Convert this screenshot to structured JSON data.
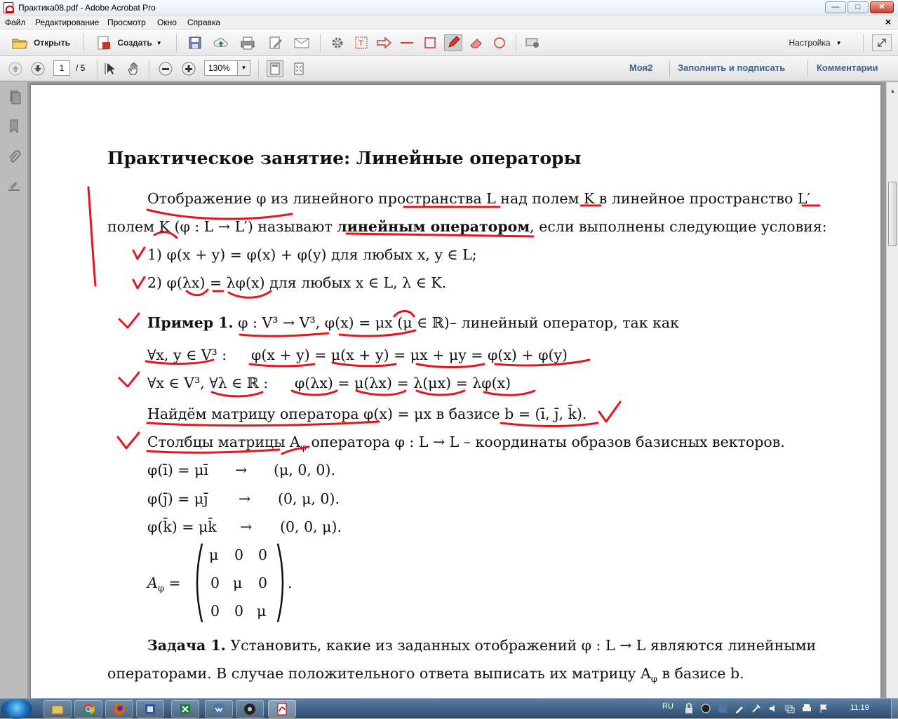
{
  "window": {
    "title": "Практика08.pdf - Adobe Acrobat Pro",
    "minimize": "—",
    "maximize": "□",
    "close": "✕"
  },
  "menu": {
    "items": [
      "Файл",
      "Редактирование",
      "Просмотр",
      "Окно",
      "Справка"
    ],
    "close_doc": "×"
  },
  "toolbar": {
    "open": "Открыть",
    "create": "Создать",
    "settings": "Настройка"
  },
  "nav": {
    "current_page": "1",
    "page_total": "/ 5",
    "zoom": "130%"
  },
  "right_links": [
    "Моя2",
    "Заполнить и подписать",
    "Комментарии"
  ],
  "document": {
    "heading": "Практическое занятие: Линейные операторы",
    "p1_line1": "Отображение φ из линейного пространства L над полем K в линейное пространство L′",
    "p1_line2_a": "полем K (φ : L → L′) называют ",
    "p1_line2_bold": "линейным оператором",
    "p1_line2_b": ", если выполнены следующие условия:",
    "cond1": "1) φ(x + y) = φ(x) + φ(y) для любых x, y ∈ L;",
    "cond2": "2) φ(λx) = λφ(x) для любых x ∈ L, λ ∈ K.",
    "ex1_bold": "Пример 1.",
    "ex1_text": " φ : V³ → V³, φ(x) = μx (μ ∈ ℝ)– линейный оператор, так как",
    "ex1_l2a": "∀x, y ∈ V³ :",
    "ex1_l2b": "φ(x + y) = μ(x + y) = μx + μy = φ(x) + φ(y)",
    "ex1_l3a": "∀x ∈ V³, ∀λ ∈ ℝ :",
    "ex1_l3b": "φ(λx) = μ(λx) = λ(μx) = λφ(x)",
    "find": "Найдём матрицу оператора φ(x) = μx в базисе b = (ī, j̄, k̄).",
    "cols": "Столбцы матрицы A_φ оператора φ :  L → L – координаты образов базисных векторов.",
    "cols_a": "Столбцы матрицы A",
    "cols_sub": "φ",
    "cols_b": " оператора φ :  L → L – координаты образов базисных векторов.",
    "img_i_lhs": "φ(ī) = μī",
    "img_i_rhs": "(μ, 0, 0).",
    "img_j_lhs": "φ(j̄) = μj̄",
    "img_j_rhs": "(0, μ, 0).",
    "img_k_lhs": "φ(k̄) = μk̄",
    "img_k_rhs": "(0, 0, μ).",
    "arrow": "→",
    "matrix_label": "A",
    "matrix_sub": "φ",
    "matrix_eq": " =",
    "matrix": [
      [
        "μ",
        "0",
        "0"
      ],
      [
        "0",
        "μ",
        "0"
      ],
      [
        "0",
        "0",
        "μ"
      ]
    ],
    "matrix_dot": ".",
    "task_bold": "Задача 1.",
    "task_line1": " Установить, какие из заданных отображений φ :  L → L являются линейными",
    "task_line2a": "операторами. В случае положительного ответа выписать их матрицу A",
    "task_line2sub": "φ",
    "task_line2b": " в базисе b."
  },
  "taskbar": {
    "lang": "RU",
    "clock": "11:19"
  },
  "colors": {
    "annotation": "#e8141b",
    "link": "#3c6490"
  }
}
